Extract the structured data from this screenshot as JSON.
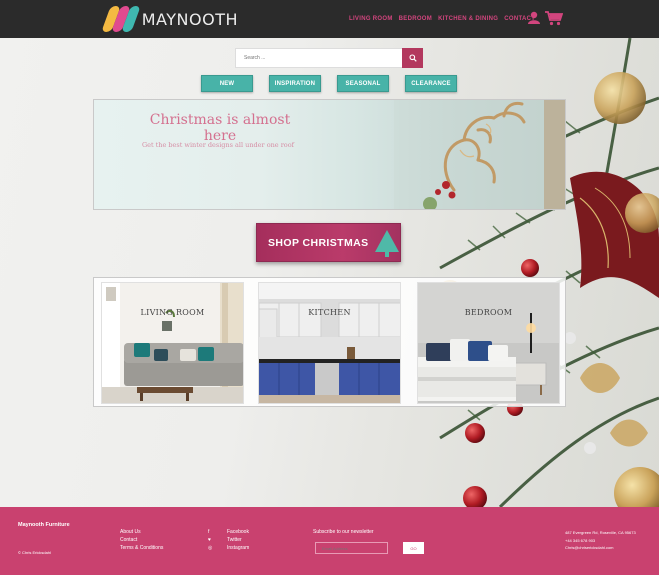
{
  "header": {
    "brand": "MAYNOOTH",
    "nav": [
      "LIVING ROOM",
      "BEDROOM",
      "KITCHEN & DINING",
      "CONTACT"
    ],
    "icons": [
      "user-icon",
      "cart-icon"
    ]
  },
  "search": {
    "placeholder": "Search ..."
  },
  "categories": [
    "NEW",
    "INSPIRATION",
    "SEASONAL",
    "CLEARANCE"
  ],
  "banner": {
    "title": "Christmas is almost here",
    "subtitle": "Get the best winter designs all under one roof"
  },
  "cta": {
    "label": "SHOP CHRISTMAS"
  },
  "rooms": [
    {
      "label": "LIVING ROOM"
    },
    {
      "label": "KITCHEN"
    },
    {
      "label": "BEDROOM"
    }
  ],
  "footer": {
    "brand": "Maynooth Furniture",
    "copyright": "© Chris Ericksdahl",
    "links": [
      "About Us",
      "Contact",
      "Terms & Conditions"
    ],
    "social": [
      "Facebook",
      "Twitter",
      "Instagram"
    ],
    "newsletter_label": "Subscribe to our newsletter",
    "email_placeholder": "Email Address",
    "go_label": "GO",
    "address": [
      "487 Evergreen Rd, Roseville, CA 95673",
      "+44 345 678 903",
      "Chris@chrisericksdahl.com"
    ]
  },
  "colors": {
    "brand_pink": "#c9416f",
    "teal": "#48b3a8",
    "header_bg": "#2b2b2b"
  }
}
